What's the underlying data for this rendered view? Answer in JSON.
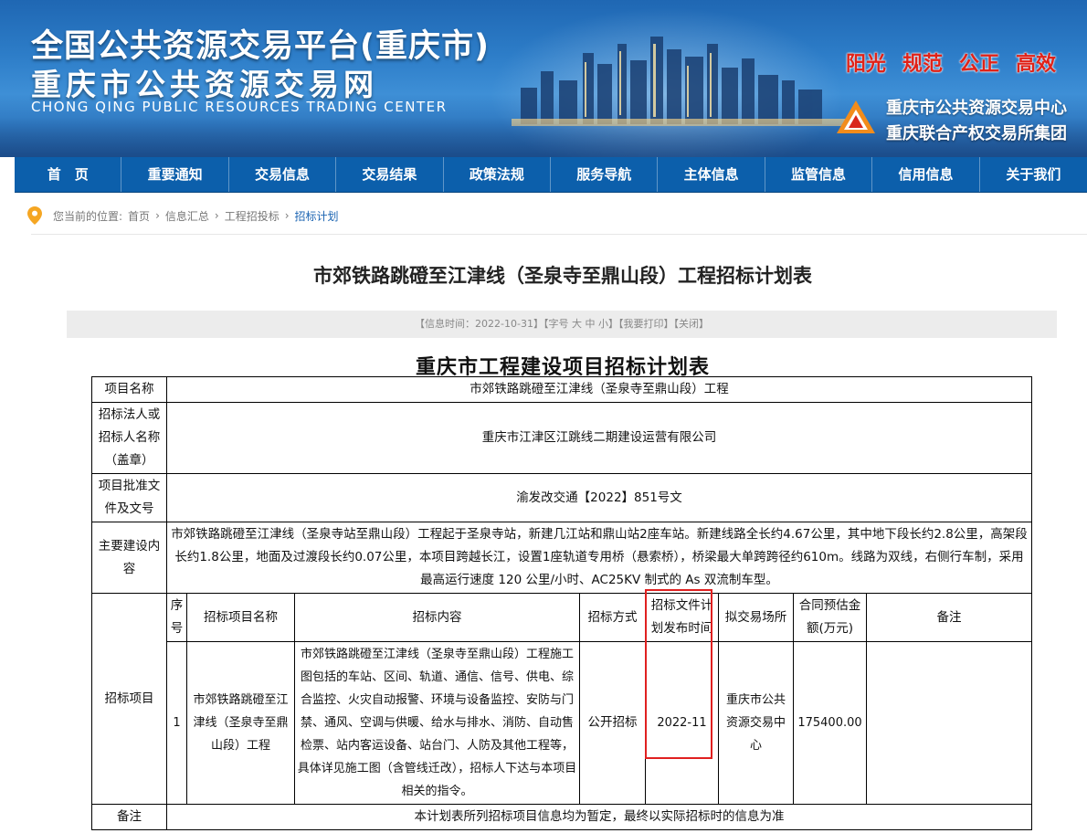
{
  "header": {
    "title_line1": "全国公共资源交易平台(重庆市)",
    "title_line2": "重庆市公共资源交易网",
    "subtitle_en": "CHONG QING PUBLIC RESOURCES TRADING CENTER",
    "slogans": [
      "阳光",
      "规范",
      "公正",
      "高效"
    ],
    "org_line1": "重庆市公共资源交易中心",
    "org_line2": "重庆联合产权交易所集团",
    "accent_color": "#e02218"
  },
  "nav": {
    "items": [
      "首　页",
      "重要通知",
      "交易信息",
      "交易结果",
      "政策法规",
      "服务导航",
      "主体信息",
      "监管信息",
      "信用信息",
      "关于我们"
    ]
  },
  "breadcrumb": {
    "prefix": "您当前的位置:",
    "items": [
      "首页",
      "信息汇总",
      "工程招投标",
      "招标计划"
    ],
    "separator": "›"
  },
  "article": {
    "title": "市郊铁路跳磴至江津线（圣泉寺至鼎山段）工程招标计划表",
    "info": {
      "time_label": "【信息时间：2022-10-31】",
      "font_label": "【字号",
      "font_large": "大",
      "font_medium": "中",
      "font_small": "小",
      "font_end": "】",
      "print": "【我要打印】",
      "close": "【关闭】"
    }
  },
  "plan": {
    "title": "重庆市工程建设项目招标计划表",
    "project_name_label": "项目名称",
    "project_name": "市郊铁路跳磴至江津线（圣泉寺至鼎山段）工程",
    "tenderer_label": "招标法人或招标人名称（盖章）",
    "tenderer": "重庆市江津区江跳线二期建设运营有限公司",
    "approval_label": "项目批准文件及文号",
    "approval": "渝发改交通【2022】851号文",
    "content_label": "主要建设内容",
    "content": "市郊铁路跳磴至江津线（圣泉寺站至鼎山段）工程起于圣泉寺站，新建几江站和鼎山站2座车站。新建线路全长约4.67公里，其中地下段长约2.8公里，高架段长约1.8公里，地面及过渡段长约0.07公里，本项目跨越长江，设置1座轨道专用桥（悬索桥），桥梁最大单跨跨径约610m。线路为双线，右侧行车制，采用最高运行速度 120 公里/小时、AC25KV 制式的 As 双流制车型。",
    "items_label": "招标项目",
    "columns": [
      "序号",
      "招标项目名称",
      "招标内容",
      "招标方式",
      "招标文件计划发布时间",
      "拟交易场所",
      "合同预估金额(万元)",
      "备注"
    ],
    "rows": [
      {
        "no": "1",
        "name": "市郊铁路跳磴至江津线（圣泉寺至鼎山段）工程",
        "content": "市郊铁路跳磴至江津线（圣泉寺至鼎山段）工程施工图包括的车站、区间、轨道、通信、信号、供电、综合监控、火灾自动报警、环境与设备监控、安防与门禁、通风、空调与供暖、给水与排水、消防、自动售检票、站内客运设备、站台门、人防及其他工程等，具体详见施工图（含管线迁改），招标人下达与本项目相关的指令。",
        "method": "公开招标",
        "release_time": "2022-11",
        "venue": "重庆市公共资源交易中心",
        "amount": "175400.00",
        "remark": ""
      }
    ],
    "note_label": "备注",
    "note": "本计划表所列招标项目信息均为暂定，最终以实际招标时的信息为准"
  }
}
